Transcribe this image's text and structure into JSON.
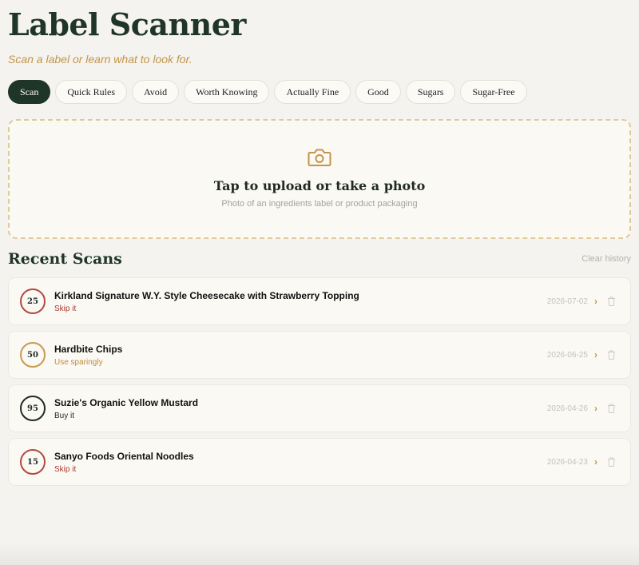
{
  "app": {
    "title": "Label Scanner",
    "subtitle": "Scan a label or learn what to look for."
  },
  "tabs": [
    {
      "label": "Scan",
      "active": true
    },
    {
      "label": "Quick Rules",
      "active": false
    },
    {
      "label": "Avoid",
      "active": false
    },
    {
      "label": "Worth Knowing",
      "active": false
    },
    {
      "label": "Actually Fine",
      "active": false
    },
    {
      "label": "Good",
      "active": false
    },
    {
      "label": "Sugars",
      "active": false
    },
    {
      "label": "Sugar-Free",
      "active": false
    }
  ],
  "upload": {
    "icon": "camera-icon",
    "title": "Tap to upload or take a photo",
    "hint": "Photo of an ingredients label or product packaging"
  },
  "recent": {
    "title": "Recent Scans",
    "clear_label": "Clear history",
    "items": [
      {
        "score": "25",
        "name": "Kirkland Signature W.Y. Style Cheesecake with Strawberry Topping",
        "verdict": "Skip it",
        "date": "2026-07-02",
        "ring_color": "#b44a40",
        "verdict_color": "#a8392f"
      },
      {
        "score": "50",
        "name": "Hardbite Chips",
        "verdict": "Use sparingly",
        "date": "2026-06-25",
        "ring_color": "#c89a52",
        "verdict_color": "#c08a3e"
      },
      {
        "score": "95",
        "name": "Suzie's Organic Yellow Mustard",
        "verdict": "Buy it",
        "date": "2026-04-26",
        "ring_color": "#1f2a24",
        "verdict_color": "#1f2a24"
      },
      {
        "score": "15",
        "name": "Sanyo Foods Oriental Noodles",
        "verdict": "Skip it",
        "date": "2026-04-23",
        "ring_color": "#b44a40",
        "verdict_color": "#a8392f"
      }
    ]
  },
  "colors": {
    "brand_dark": "#1f3527",
    "accent_gold": "#c2954b",
    "background": "#f4f3ef"
  }
}
